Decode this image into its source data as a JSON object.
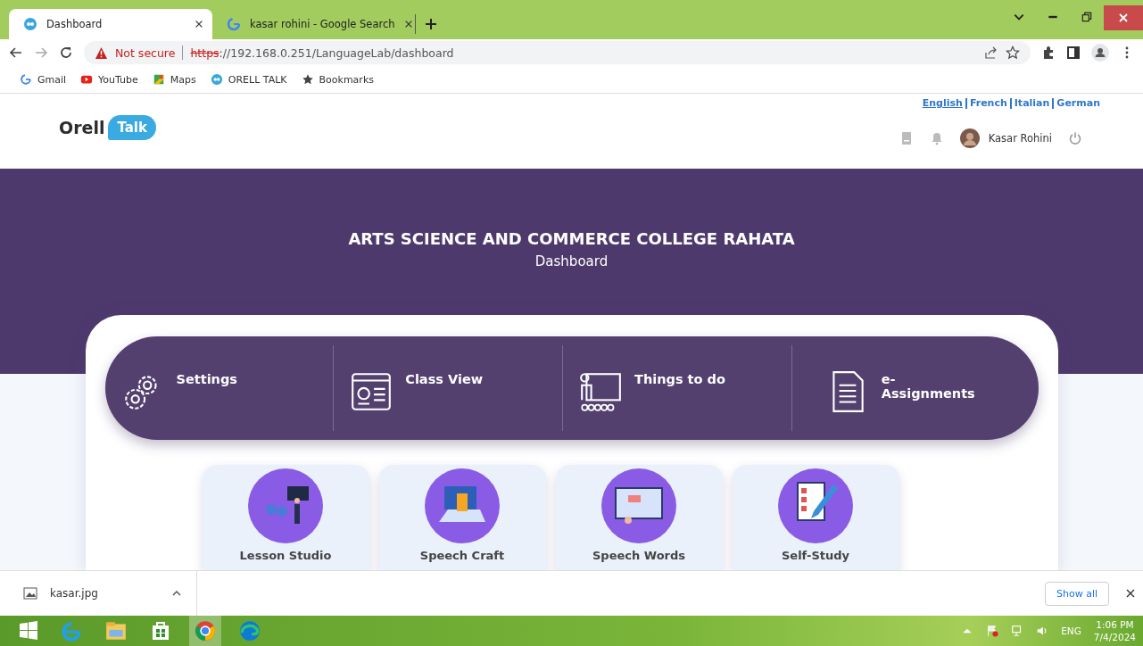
{
  "browser": {
    "tabs": [
      {
        "title": "Dashboard",
        "kind": "orell",
        "selected": true
      },
      {
        "title": "kasar rohini - Google Search",
        "kind": "google",
        "selected": false
      }
    ],
    "security": "Not secure",
    "url_scheme": "https",
    "url_rest": "://192.168.0.251/LanguageLab/dashboard",
    "bookmarks": [
      {
        "label": "Gmail",
        "kind": "google"
      },
      {
        "label": "YouTube",
        "kind": "youtube"
      },
      {
        "label": "Maps",
        "kind": "maps"
      },
      {
        "label": "ORELL TALK",
        "kind": "orell"
      },
      {
        "label": "Bookmarks",
        "kind": "star"
      }
    ]
  },
  "header": {
    "logo_word": "Orell",
    "logo_bubble": "Talk",
    "languages": [
      {
        "label": "English",
        "selected": true
      },
      {
        "label": "French",
        "selected": false
      },
      {
        "label": "Italian",
        "selected": false
      },
      {
        "label": "German",
        "selected": false
      }
    ],
    "user": "Kasar Rohini"
  },
  "banner": {
    "college": "ARTS SCIENCE AND COMMERCE COLLEGE RAHATA",
    "subtitle": "Dashboard"
  },
  "quick_links": [
    {
      "label": "Settings",
      "kind": "gears"
    },
    {
      "label": "Class View",
      "kind": "window"
    },
    {
      "label": "Things to do",
      "kind": "board"
    },
    {
      "label": "e-\nAssignments",
      "kind": "document"
    }
  ],
  "modules": [
    {
      "title": "Lesson Studio",
      "kind": "classroom"
    },
    {
      "title": "Speech Craft",
      "kind": "laptop"
    },
    {
      "title": "Speech Words",
      "kind": "screen"
    },
    {
      "title": "Self-Study",
      "kind": "checklist"
    }
  ],
  "downloads": {
    "file": "kasar.jpg",
    "show_all": "Show all"
  },
  "taskbar": {
    "apps": [
      {
        "kind": "ie",
        "selected": false
      },
      {
        "kind": "explorer",
        "selected": false
      },
      {
        "kind": "store",
        "selected": false
      },
      {
        "kind": "chrome",
        "selected": true
      },
      {
        "kind": "edge",
        "selected": false
      }
    ],
    "language": "ENG",
    "time": "1:06 PM",
    "date": "7/4/2024"
  }
}
